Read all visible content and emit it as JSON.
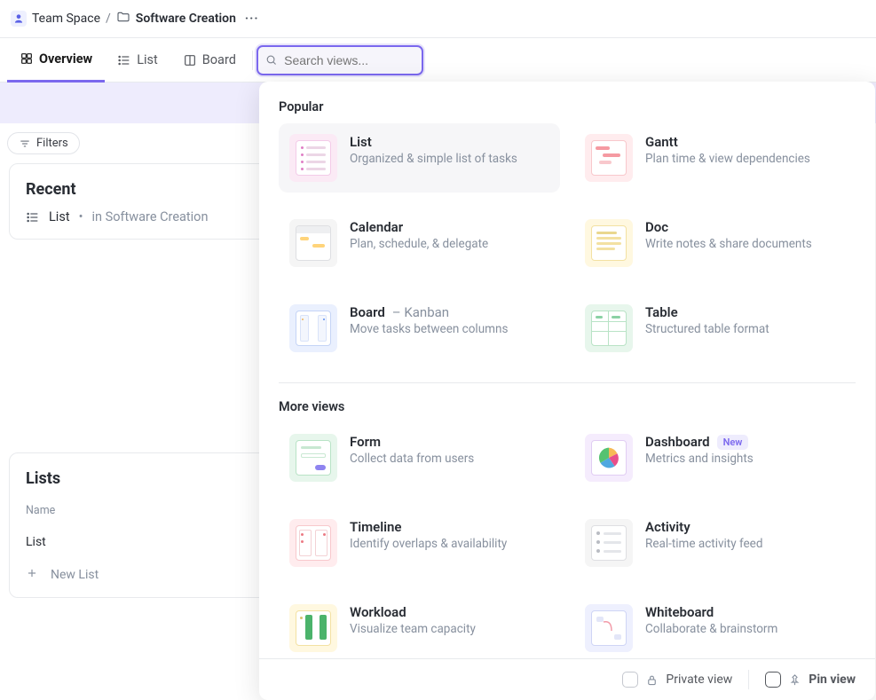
{
  "breadcrumb": {
    "team": "Team Space",
    "space": "Software Creation"
  },
  "tabs": {
    "overview": "Overview",
    "list": "List",
    "board": "Board"
  },
  "search": {
    "placeholder": "Search views..."
  },
  "filters": {
    "label": "Filters"
  },
  "recent": {
    "title": "Recent",
    "item_name": "List",
    "item_loc": "in Software Creation"
  },
  "lists": {
    "title": "Lists",
    "header": "Name",
    "item": "List",
    "new": "New List"
  },
  "panel": {
    "section_popular": "Popular",
    "section_more": "More views",
    "options": {
      "list": {
        "title": "List",
        "sub": "Organized & simple list of tasks",
        "thumb": "#fbeaf5"
      },
      "gantt": {
        "title": "Gantt",
        "sub": "Plan time & view dependencies",
        "thumb": "#ffecee"
      },
      "calendar": {
        "title": "Calendar",
        "sub": "Plan, schedule, & delegate",
        "thumb": "#f5f5f5"
      },
      "doc": {
        "title": "Doc",
        "sub": "Write notes & share documents",
        "thumb": "#fff8e0"
      },
      "board": {
        "title": "Board",
        "subtitle": "Kanban",
        "sub": "Move tasks between columns",
        "thumb": "#eaf0fe"
      },
      "table": {
        "title": "Table",
        "sub": "Structured table format",
        "thumb": "#e7f6ec"
      },
      "form": {
        "title": "Form",
        "sub": "Collect data from users",
        "thumb": "#e7f6ec"
      },
      "dashboard": {
        "title": "Dashboard",
        "sub": "Metrics and insights",
        "badge": "New",
        "thumb": "#f5ecfd"
      },
      "timeline": {
        "title": "Timeline",
        "sub": "Identify overlaps & availability",
        "thumb": "#ffecee"
      },
      "activity": {
        "title": "Activity",
        "sub": "Real-time activity feed",
        "thumb": "#f5f5f5"
      },
      "workload": {
        "title": "Workload",
        "sub": "Visualize team capacity",
        "thumb": "#fff8e0"
      },
      "whiteboard": {
        "title": "Whiteboard",
        "sub": "Collaborate & brainstorm",
        "thumb": "#eef0fe"
      }
    },
    "footer": {
      "private": "Private view",
      "pin": "Pin view"
    }
  }
}
